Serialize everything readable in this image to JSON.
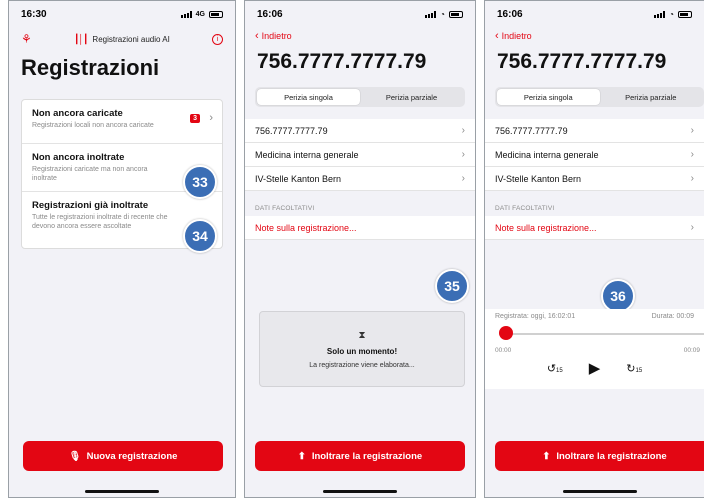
{
  "phone1": {
    "time": "16:30",
    "network": "4G",
    "brand": "Registrazioni audio AI",
    "title": "Registrazioni",
    "items": [
      {
        "title": "Non ancora caricate",
        "subtitle": "Registrazioni locali non ancora caricate",
        "badge": "3"
      },
      {
        "title": "Non ancora inoltrate",
        "subtitle": "Registrazioni caricate ma non ancora inoltrate",
        "callout": "33"
      },
      {
        "title": "Registrazioni già inoltrate",
        "subtitle": "Tutte le registrazioni inoltrate di recente che devono ancora essere ascoltate",
        "callout": "34"
      }
    ],
    "button": "Nuova registrazione"
  },
  "phone2": {
    "time": "16:06",
    "back": "Indietro",
    "title": "756.7777.7777.79",
    "segments": [
      "Perizia singola",
      "Perizia parziale"
    ],
    "rows": [
      "756.7777.7777.79",
      "Medicina interna generale",
      "IV-Stelle Kanton Bern"
    ],
    "section": "DATI FACOLTATIVI",
    "note": "Note sulla registrazione...",
    "callout": "35",
    "loading_title": "Solo un momento!",
    "loading_sub": "La registrazione viene elaborata...",
    "button": "Inoltrare la registrazione"
  },
  "phone3": {
    "time": "16:06",
    "back": "Indietro",
    "title": "756.7777.7777.79",
    "segments": [
      "Perizia singola",
      "Perizia parziale"
    ],
    "rows": [
      "756.7777.7777.79",
      "Medicina interna generale",
      "IV-Stelle Kanton Bern"
    ],
    "section": "DATI FACOLTATIVI",
    "note": "Note sulla registrazione...",
    "callout": "36",
    "recorded": "Registrata: oggi, 16:02:01",
    "duration": "Durata: 00:09",
    "time_start": "00:00",
    "time_end": "00:09",
    "skip_back": "15",
    "skip_fwd": "15",
    "playback_progress": 0,
    "button": "Inoltrare la registrazione"
  },
  "colors": {
    "accent": "#e30613",
    "callout": "#3b6eb5"
  }
}
